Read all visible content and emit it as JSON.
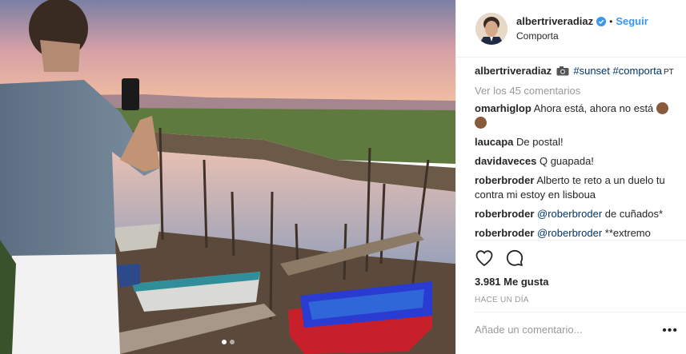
{
  "post": {
    "username": "albertriveradiaz",
    "follow_label": "Seguir",
    "separator": "•",
    "location": "Comporta"
  },
  "caption": {
    "username": "albertriveradiaz",
    "hashtag1": "#sunset",
    "hashtag2": "#comporta",
    "suffix": "PT"
  },
  "view_comments": "Ver los 45 comentarios",
  "comments": [
    {
      "user": "omarhiglop",
      "text": "Ahora está, ahora no está"
    },
    {
      "user": "laucapa",
      "text": "De postal!"
    },
    {
      "user": "davidaveces",
      "text": "Q guapada!"
    },
    {
      "user": "roberbroder",
      "text": "Alberto te reto a un duelo tu contra mi estoy en lisboua"
    },
    {
      "user": "roberbroder",
      "mention": "@roberbroder",
      "text": "de cuñados*"
    },
    {
      "user": "roberbroder",
      "mention": "@roberbroder",
      "text": "**extremo"
    }
  ],
  "likes": {
    "count": "3.981",
    "label": "Me gusta"
  },
  "timestamp": "HACE UN DÍA",
  "add_comment_placeholder": "Añade un comentario...",
  "icons": {
    "verified": "verified-badge-icon",
    "like": "heart-icon",
    "comment": "speech-bubble-icon",
    "camera": "camera-emoji-icon",
    "monkey": "see-no-evil-monkey-emoji-icon",
    "more": "more-options-icon"
  },
  "colors": {
    "link": "#3897f0",
    "hashtag": "#003569",
    "muted": "#999999",
    "text": "#262626"
  }
}
